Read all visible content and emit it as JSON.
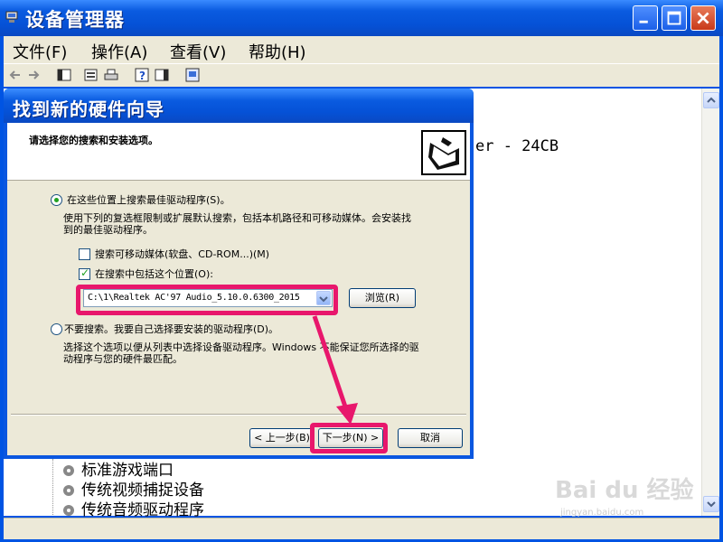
{
  "window": {
    "title": "设备管理器",
    "menu": [
      "文件(F)",
      "操作(A)",
      "查看(V)",
      "帮助(H)"
    ]
  },
  "background": {
    "device_partial_text": "er - 24CB",
    "tree_items": [
      "标准游戏端口",
      "传统视频捕捉设备",
      "传统音频驱动程序"
    ]
  },
  "dialog": {
    "title": "找到新的硬件向导",
    "header": "请选择您的搜索和安装选项。",
    "option1": {
      "label": "在这些位置上搜索最佳驱动程序(S)。",
      "desc_line1": "使用下列的复选框限制或扩展默认搜索，包括本机路径和可移动媒体。会安装找",
      "desc_line2": "到的最佳驱动程序。",
      "selected": true
    },
    "check_removable": {
      "label": "搜索可移动媒体(软盘、CD-ROM...)(M)",
      "checked": false
    },
    "check_include": {
      "label": "在搜索中包括这个位置(O):",
      "checked": true
    },
    "path_value": "C:\\1\\Realtek AC'97 Audio_5.10.0.6300_2015",
    "browse_label": "浏览(R)",
    "option2": {
      "label": "不要搜索。我要自己选择要安装的驱动程序(D)。",
      "desc_line1": "选择这个选项以便从列表中选择设备驱动程序。Windows 不能保证您所选择的驱",
      "desc_line2": "动程序与您的硬件最匹配。",
      "selected": false
    },
    "back_label": "< 上一步(B)",
    "next_label": "下一步(N) >",
    "cancel_label": "取消"
  },
  "watermark": {
    "brand": "Bai du 经验",
    "url": "jingyan.baidu.com"
  },
  "colors": {
    "highlight": "#E8176C",
    "xp_blue": "#0A5BE0"
  }
}
